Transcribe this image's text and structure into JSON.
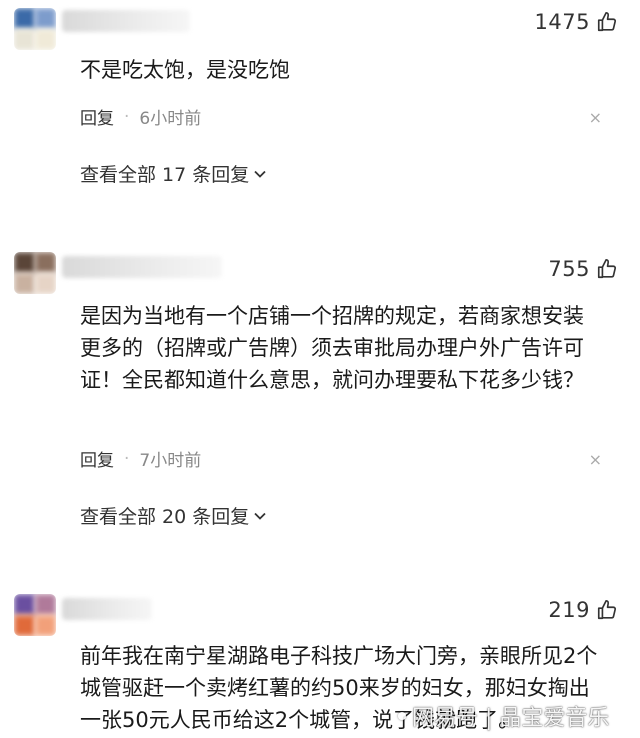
{
  "comments": [
    {
      "likes": "1475",
      "text": "不是吃太饱，是没吃饱",
      "reply_label": "回复",
      "time": "6小时前",
      "close": "×",
      "view_all": "查看全部 17 条回复",
      "avatar_colors": [
        "#3b6aa8",
        "#7d9ccc",
        "#e8e4d6",
        "#f0ead8"
      ]
    },
    {
      "likes": "755",
      "text": "是因为当地有一个店铺一个招牌的规定，若商家想安装更多的（招牌或广告牌）须去审批局办理户外广告许可证！全民都知道什么意思，就问办理要私下花多少钱？",
      "reply_label": "回复",
      "time": "7小时前",
      "close": "×",
      "view_all": "查看全部 20 条回复",
      "avatar_colors": [
        "#5a4538",
        "#8a6f5e",
        "#c9b1a0",
        "#e6d4c6"
      ]
    },
    {
      "likes": "219",
      "text": "前年我在南宁星湖路电子科技广场大门旁，亲眼所见2个城管驱赶一个卖烤红薯的约50来岁的妇女，那妇女掏出一张50元人民币给这2个城管，说了钱就跑了。",
      "avatar_colors": [
        "#6a4fa0",
        "#b07a9a",
        "#e06a3a",
        "#f2a07a"
      ]
    }
  ],
  "watermark": {
    "text": "网易号 | 晶宝爱音乐"
  },
  "icons": {
    "like": "thumbs-up-icon",
    "chevron": "chevron-down-icon"
  }
}
